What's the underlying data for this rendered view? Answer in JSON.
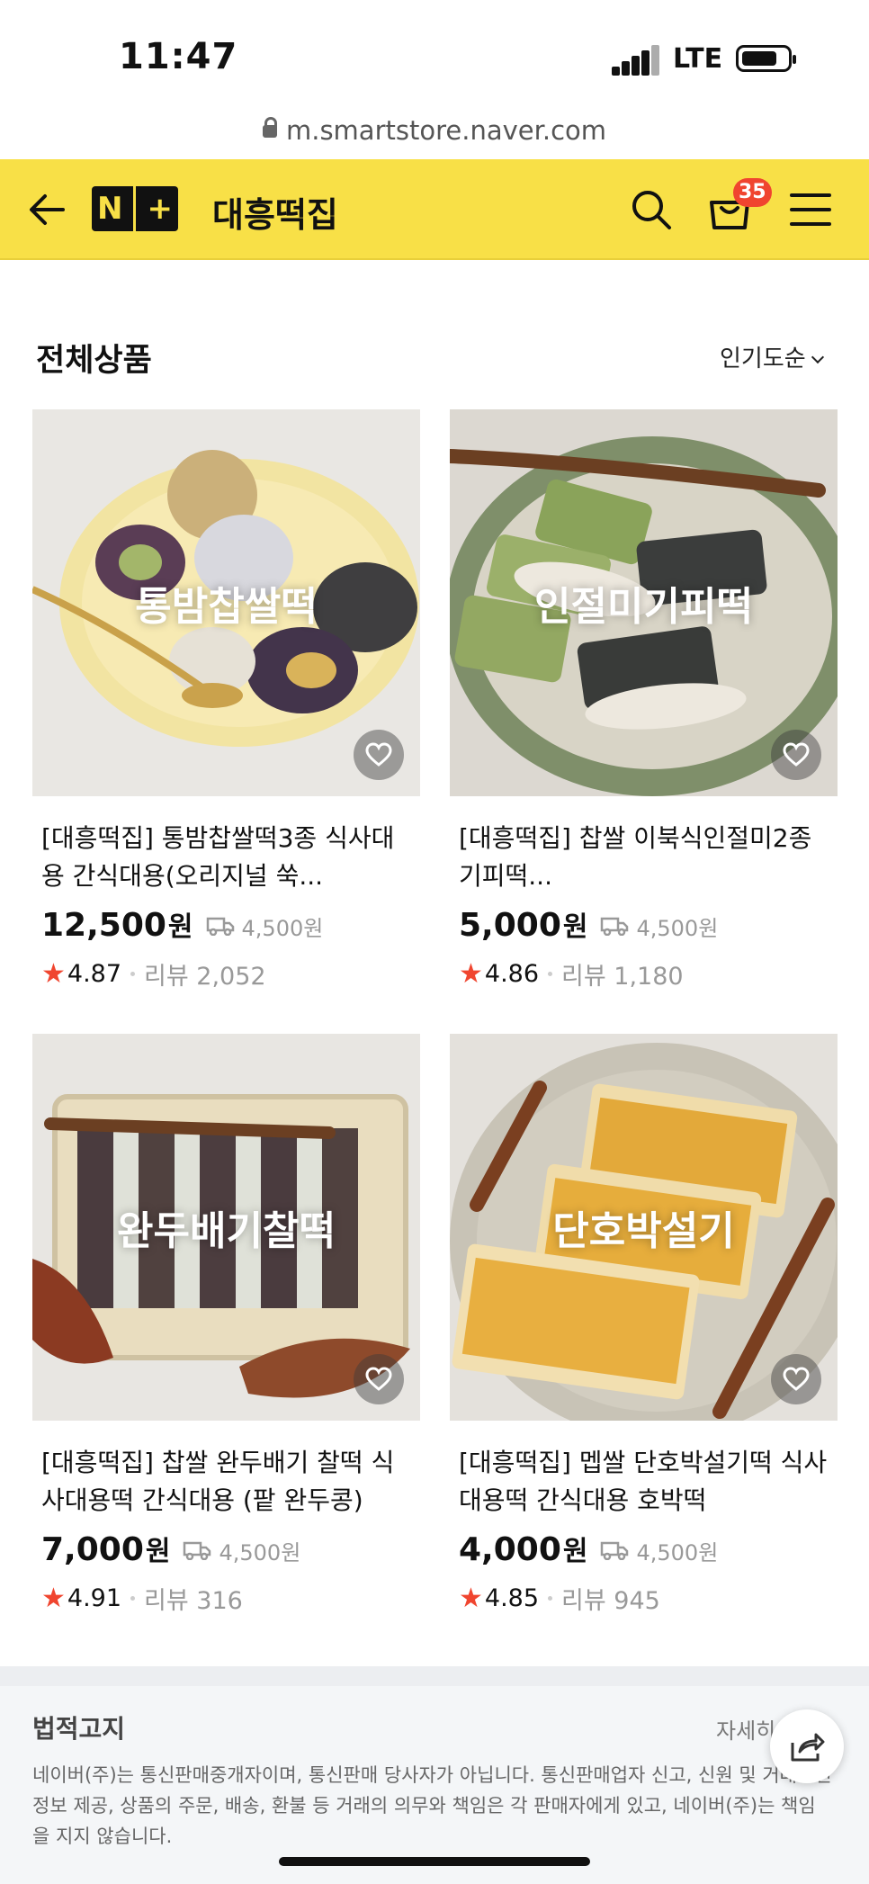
{
  "status_bar": {
    "time": "11:47",
    "network": "LTE"
  },
  "browser": {
    "url": "m.smartstore.naver.com"
  },
  "header": {
    "logo_text": "N+",
    "store_name": "대흥떡집",
    "cart_count": "35",
    "icons": [
      "back-arrow-icon",
      "search-icon",
      "cart-icon",
      "menu-icon"
    ],
    "background_color": "#f8e047"
  },
  "list": {
    "title": "전체상품",
    "sort_label": "인기도순"
  },
  "products": [
    {
      "overlay": "통밤찹쌀떡",
      "title": "[대흥떡집] 통밤찹쌀떡3종 식사대용 간식대용(오리지널 쑥...",
      "price": "12,500",
      "price_unit": "원",
      "shipping": "4,500원",
      "rating": "4.87",
      "review": "리뷰 2,052"
    },
    {
      "overlay": "인절미기피떡",
      "title": "[대흥떡집] 찹쌀 이북식인절미2종 기피떡...",
      "price": "5,000",
      "price_unit": "원",
      "shipping": "4,500원",
      "rating": "4.86",
      "review": "리뷰 1,180"
    },
    {
      "overlay": "완두배기찰떡",
      "title": "[대흥떡집] 찹쌀 완두배기 찰떡 식사대용떡 간식대용 (팥 완두콩)",
      "price": "7,000",
      "price_unit": "원",
      "shipping": "4,500원",
      "rating": "4.91",
      "review": "리뷰 316"
    },
    {
      "overlay": "단호박설기",
      "title": "[대흥떡집] 멥쌀 단호박설기떡 식사대용떡 간식대용 호박떡",
      "price": "4,000",
      "price_unit": "원",
      "shipping": "4,500원",
      "rating": "4.85",
      "review": "리뷰 945"
    }
  ],
  "legal": {
    "title": "법적고지",
    "more": "자세히",
    "text": "네이버(주)는 통신판매중개자이며, 통신판매 당사자가 아닙니다. 통신판매업자 신고, 신원 및 거래조건 정보 제공, 상품의 주문, 배송, 환불 등 거래의 의무와 책임은 각 판매자에게 있고, 네이버(주)는 책임을 지지 않습니다."
  }
}
